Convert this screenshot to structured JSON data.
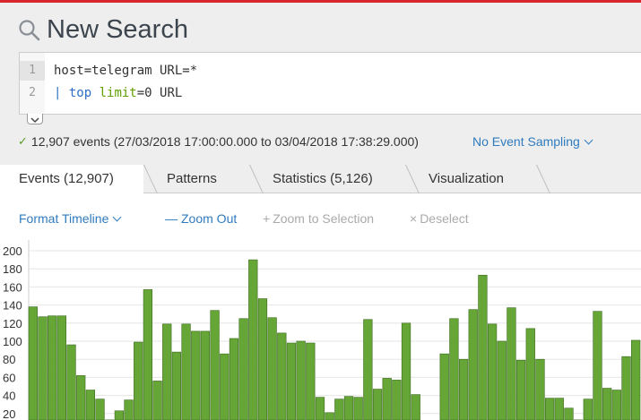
{
  "header": {
    "title": "New Search"
  },
  "editor": {
    "line_numbers": [
      "1",
      "2"
    ],
    "line1": "host=telegram URL=*",
    "line2_pipe": "| ",
    "line2_cmd": "top",
    "line2_space": " ",
    "line2_arg": "limit",
    "line2_rest": "=0 URL"
  },
  "status": {
    "events_summary": "12,907 events (27/03/2018 17:00:00.000 to 03/04/2018 17:38:29.000)",
    "sampling_label": "No Event Sampling"
  },
  "tabs": [
    {
      "label": "Events (12,907)",
      "active": true
    },
    {
      "label": "Patterns",
      "active": false
    },
    {
      "label": "Statistics (5,126)",
      "active": false
    },
    {
      "label": "Visualization",
      "active": false
    }
  ],
  "toolbar": {
    "format_timeline": "Format Timeline",
    "zoom_out": "Zoom Out",
    "zoom_to_selection": "Zoom to Selection",
    "deselect": "Deselect"
  },
  "colors": {
    "bar_fill": "#65a637",
    "bar_stroke": "#3d6b1f",
    "link_blue": "#2f7bbf",
    "accent_red": "#d9252d"
  },
  "chart_data": {
    "type": "bar",
    "ylabels": [
      "200",
      "180",
      "160",
      "140",
      "120",
      "100",
      "80",
      "60",
      "40",
      "20"
    ],
    "ylim": [
      0,
      200
    ],
    "grid": true,
    "values": [
      138,
      127,
      128,
      128,
      96,
      62,
      46,
      36,
      13,
      23,
      35,
      99,
      157,
      56,
      119,
      88,
      119,
      111,
      111,
      134,
      86,
      103,
      125,
      190,
      147,
      126,
      109,
      98,
      100,
      98,
      38,
      21,
      36,
      39,
      38,
      124,
      47,
      59,
      57,
      120,
      41,
      0,
      0,
      86,
      125,
      80,
      135,
      173,
      119,
      100,
      137,
      79,
      114,
      80,
      37,
      37,
      26,
      13,
      36,
      133,
      48,
      46,
      83,
      101
    ]
  }
}
